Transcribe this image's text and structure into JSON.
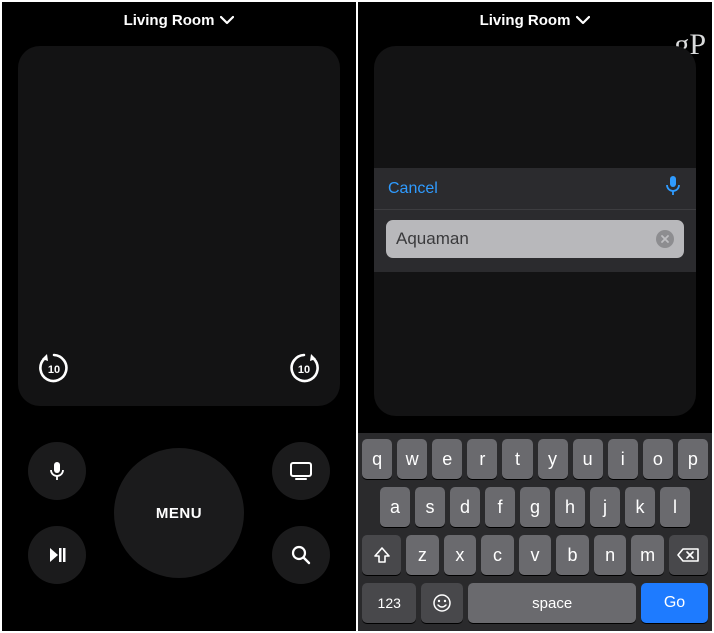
{
  "left": {
    "header": {
      "title": "Living Room"
    },
    "skip_seconds": "10",
    "menu_label": "MENU"
  },
  "right": {
    "header": {
      "title": "Living Room"
    },
    "watermark": "gP",
    "input": {
      "cancel_label": "Cancel",
      "value": "Aquaman"
    },
    "keyboard": {
      "row1": [
        "q",
        "w",
        "e",
        "r",
        "t",
        "y",
        "u",
        "i",
        "o",
        "p"
      ],
      "row2": [
        "a",
        "s",
        "d",
        "f",
        "g",
        "h",
        "j",
        "k",
        "l"
      ],
      "row3": [
        "z",
        "x",
        "c",
        "v",
        "b",
        "n",
        "m"
      ],
      "numkey": "123",
      "space": "space",
      "go": "Go"
    }
  }
}
